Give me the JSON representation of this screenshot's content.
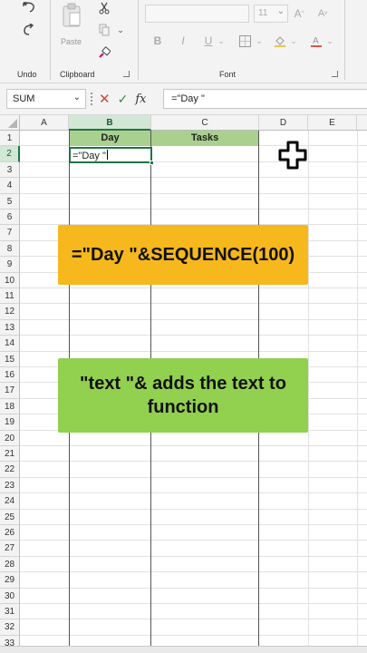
{
  "ribbon": {
    "groups": {
      "undo": "Undo",
      "clipboard": "Clipboard",
      "font": "Font"
    },
    "paste_label": "Paste",
    "font_size": "11"
  },
  "formula_bar": {
    "name_box": "SUM",
    "formula": "=\"Day \""
  },
  "grid": {
    "columns": [
      "A",
      "B",
      "C",
      "D",
      "E"
    ],
    "selected_column": "B",
    "rows": [
      "1",
      "2",
      "3",
      "4",
      "5",
      "6",
      "7",
      "8",
      "9",
      "10",
      "11",
      "12",
      "13",
      "14",
      "15",
      "16",
      "17",
      "18",
      "19",
      "20",
      "21",
      "22",
      "23",
      "24",
      "25",
      "26",
      "27",
      "28",
      "29",
      "30",
      "31",
      "32",
      "33"
    ],
    "selected_row": "2",
    "headers": {
      "b1": "Day",
      "c1": "Tasks"
    },
    "active_cell_value": "=\"Day \""
  },
  "callouts": {
    "formula": "=\"Day \"&SEQUENCE(100)",
    "explanation": "\"text \"& adds the text to function"
  },
  "colors": {
    "header_fill": "#a9d08e",
    "callout_orange": "#f6b81c",
    "callout_green": "#92d050",
    "excel_green": "#217346"
  }
}
